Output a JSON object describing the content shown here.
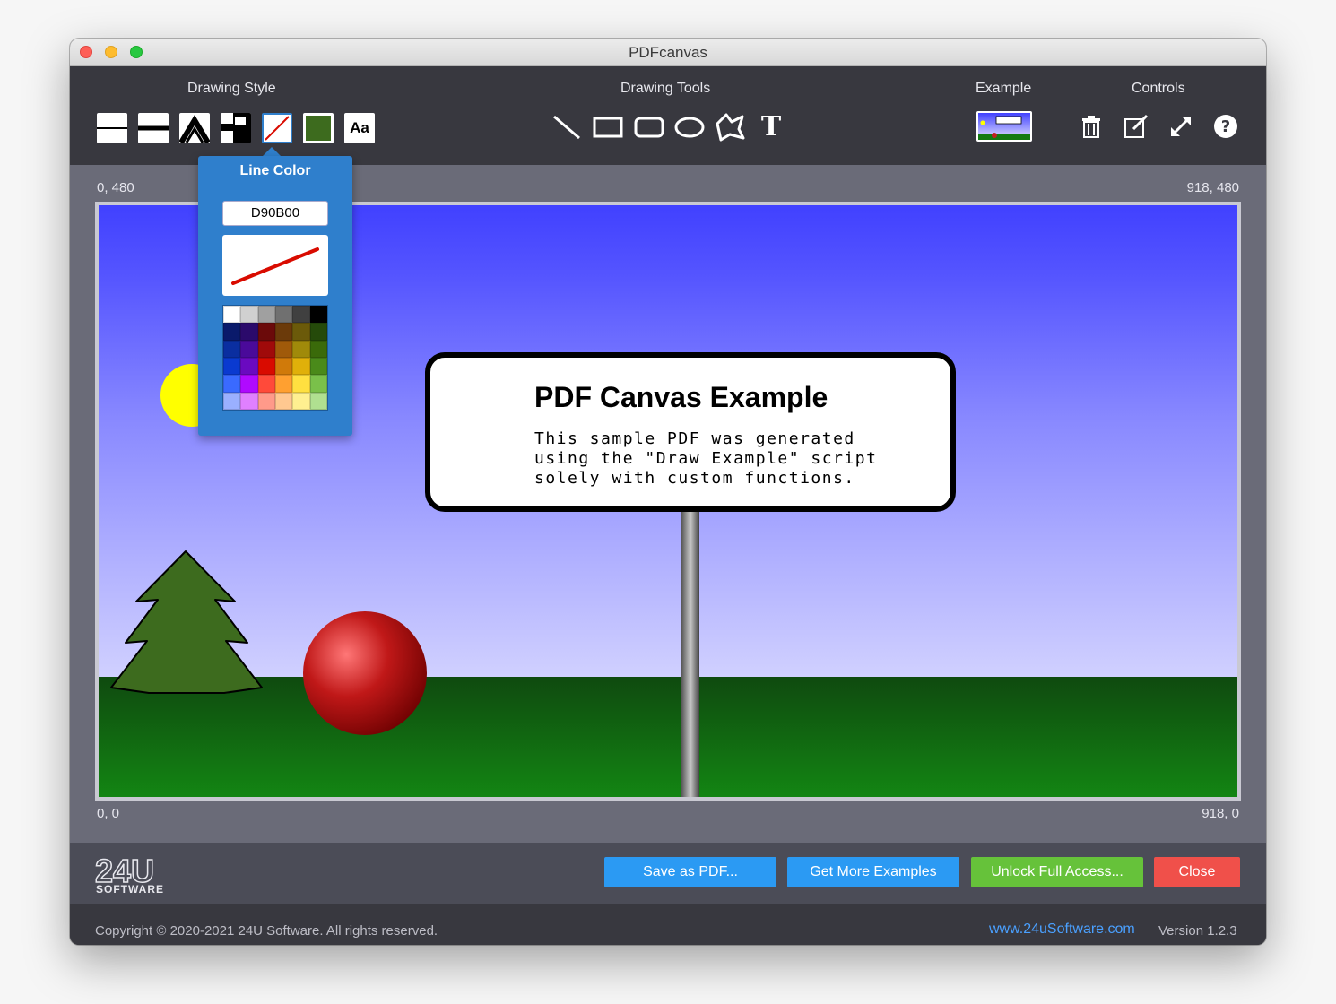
{
  "window": {
    "title": "PDFcanvas"
  },
  "toolbar": {
    "drawing_style_label": "Drawing Style",
    "drawing_tools_label": "Drawing Tools",
    "example_label": "Example",
    "controls_label": "Controls",
    "style_buttons": [
      "thin-line-icon",
      "thick-line-icon",
      "line-join-icon",
      "line-cap-icon",
      "line-color-icon",
      "fill-color-icon",
      "text-style-icon"
    ],
    "fill_color": "#3d6b1e",
    "font_button_text": "Aa",
    "tools": [
      "line-tool-icon",
      "rectangle-tool-icon",
      "rounded-rectangle-tool-icon",
      "ellipse-tool-icon",
      "polygon-tool-icon",
      "text-tool-icon"
    ],
    "text_tool_glyph": "T",
    "controls": [
      "trash-icon",
      "edit-icon",
      "expand-icon",
      "help-icon"
    ]
  },
  "canvas": {
    "top_left_coord": "0, 480",
    "top_right_coord": "918, 480",
    "bottom_left_coord": "0, 0",
    "bottom_right_coord": "918, 0",
    "sign_title": "PDF Canvas Example",
    "sign_text": "This sample PDF was generated\nusing the \"Draw Example\" script\nsolely with custom functions."
  },
  "line_color_popover": {
    "title": "Line Color",
    "hex_value": "D90B00",
    "selected_color": "#d90b00",
    "palette": [
      "#ffffff",
      "#d0d0d0",
      "#a0a0a0",
      "#707070",
      "#404040",
      "#000000",
      "#0a1a6b",
      "#2b0a6b",
      "#6b0a0a",
      "#6b3a0a",
      "#6b5a0a",
      "#254a0a",
      "#0a2ea0",
      "#4a0a9a",
      "#a00a0a",
      "#a05a0a",
      "#a08a0a",
      "#3a6a0a",
      "#0a3ad0",
      "#6a0ac0",
      "#d90b00",
      "#d07a0a",
      "#e0b00a",
      "#4a8a1a",
      "#3a6aff",
      "#b00aff",
      "#ff4a3a",
      "#ffa030",
      "#ffe040",
      "#7ac04a",
      "#9ab0ff",
      "#e080ff",
      "#ff9a8a",
      "#ffc890",
      "#fff090",
      "#b0e090"
    ]
  },
  "bottom": {
    "logo_text": "24U",
    "logo_sub": "SOFTWARE",
    "save_label": "Save as PDF...",
    "examples_label": "Get More Examples",
    "unlock_label": "Unlock Full Access...",
    "close_label": "Close",
    "colors": {
      "save": "#2b9af3",
      "examples": "#2b9af3",
      "unlock": "#66c23a",
      "close": "#f0504a"
    }
  },
  "footer": {
    "copyright": "Copyright © 2020-2021 24U Software. All rights reserved.",
    "website": "www.24uSoftware.com",
    "version": "Version 1.2.3"
  }
}
